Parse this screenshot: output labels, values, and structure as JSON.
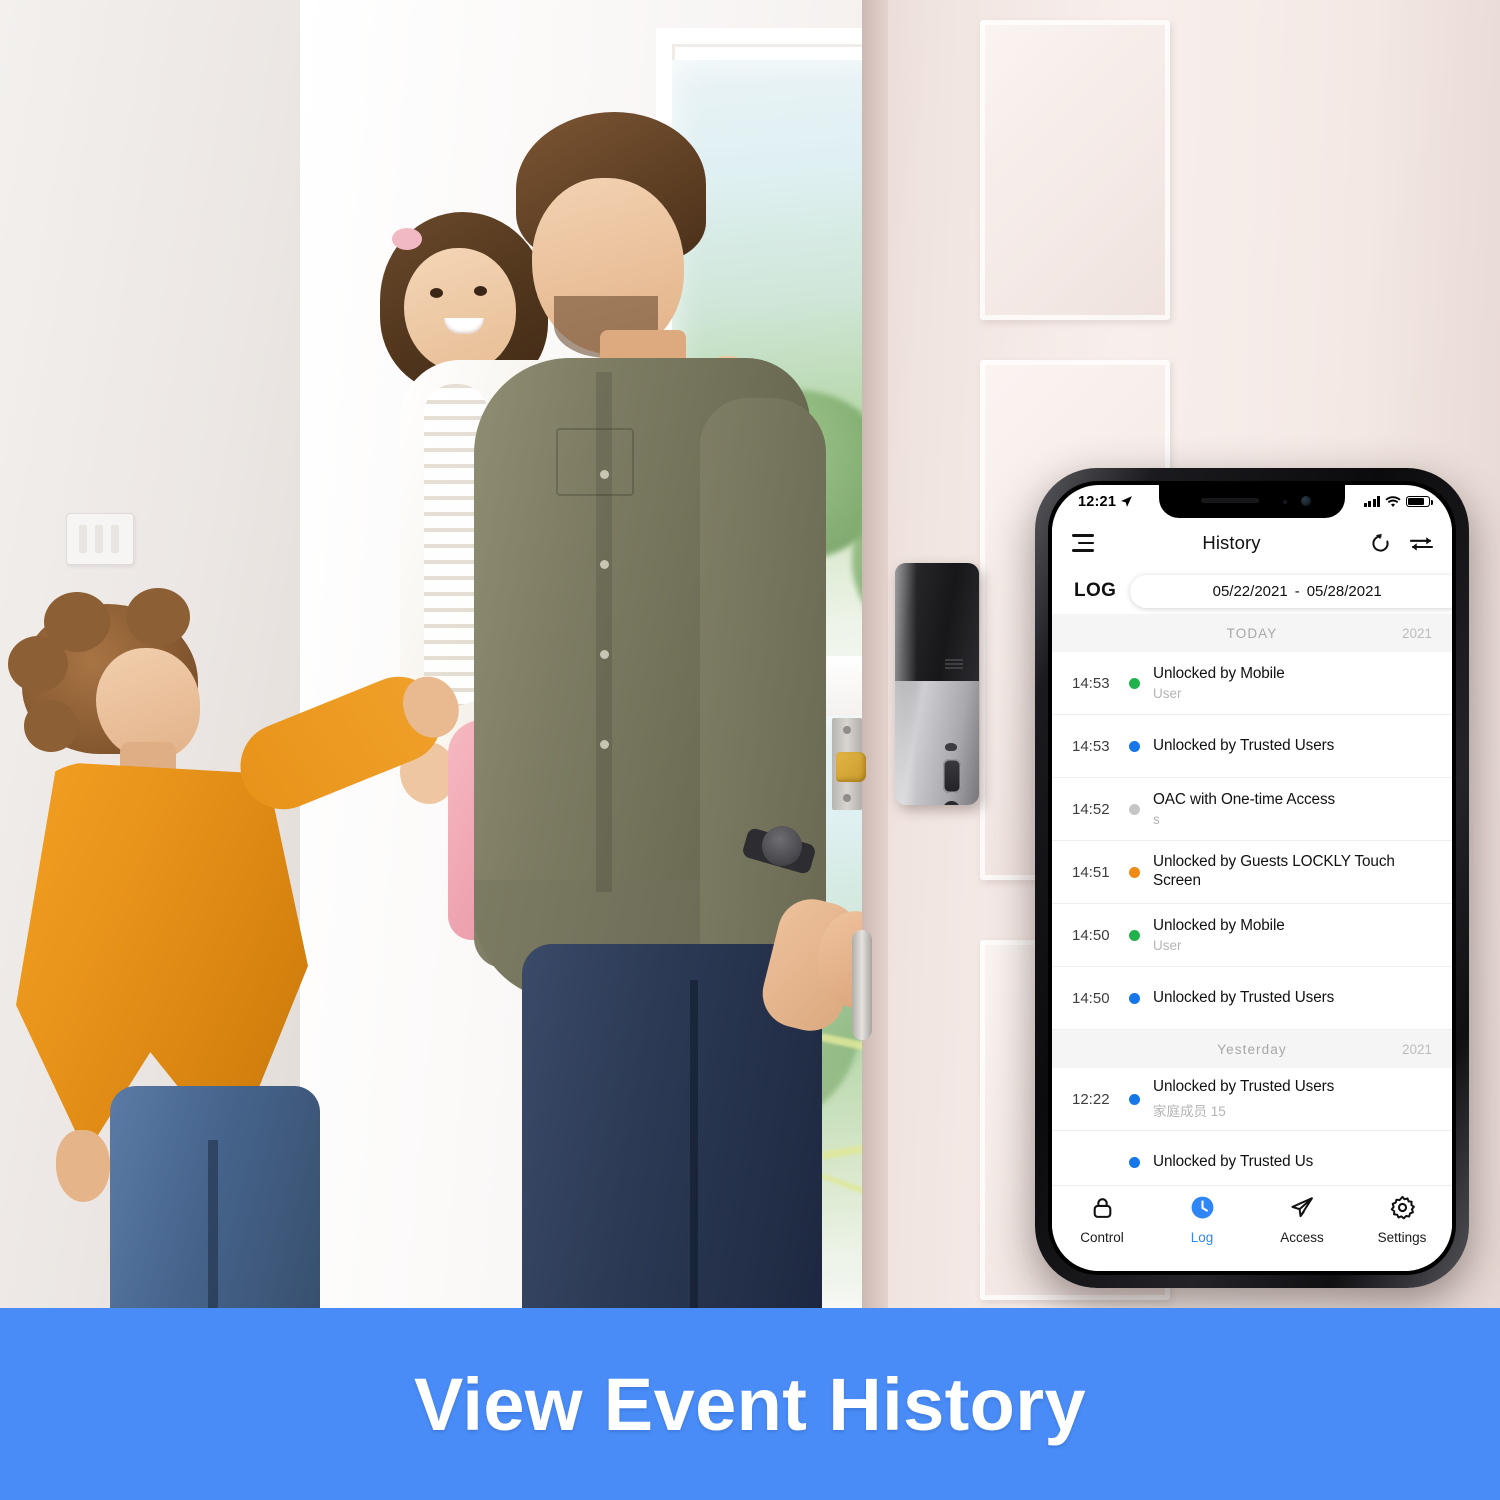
{
  "banner": {
    "headline": "View Event History",
    "color": "#4a8cf7"
  },
  "scene": {
    "description": "father carrying daughter on shoulders and son holding hands entering a front door with a smart lock",
    "smart_lock": "lockly-smart-deadbolt"
  },
  "phone": {
    "status_bar": {
      "time": "12:21",
      "location_icon": "location-arrow-icon",
      "signal_icon": "cellular-signal-icon",
      "wifi_icon": "wifi-icon",
      "battery_icon": "battery-icon"
    },
    "nav": {
      "menu_icon": "hamburger-menu-icon",
      "title": "History",
      "refresh_icon": "refresh-icon",
      "swap_icon": "transfer-swap-icon"
    },
    "log_header": {
      "label": "LOG",
      "date_start": "05/22/2021",
      "date_separator": "-",
      "date_end": "05/28/2021"
    },
    "sections": [
      {
        "title": "TODAY",
        "year": "2021",
        "rows": [
          {
            "time": "14:53",
            "dot": "#22b24c",
            "dot_name": "green",
            "title": "Unlocked by Mobile",
            "subtitle": "User"
          },
          {
            "time": "14:53",
            "dot": "#1677e8",
            "dot_name": "blue",
            "title": "Unlocked by Trusted Users",
            "subtitle": ""
          },
          {
            "time": "14:52",
            "dot": "#c6c6c6",
            "dot_name": "gray",
            "title": "OAC with One-time Access",
            "subtitle": "s"
          },
          {
            "time": "14:51",
            "dot": "#ef8a17",
            "dot_name": "orange",
            "title": "Unlocked by Guests LOCKLY Touch Screen",
            "subtitle": ""
          },
          {
            "time": "14:50",
            "dot": "#22b24c",
            "dot_name": "green",
            "title": "Unlocked by Mobile",
            "subtitle": "User"
          },
          {
            "time": "14:50",
            "dot": "#1677e8",
            "dot_name": "blue",
            "title": "Unlocked by Trusted Users",
            "subtitle": ""
          }
        ]
      },
      {
        "title": "Yesterday",
        "year": "2021",
        "rows": [
          {
            "time": "12:22",
            "dot": "#1677e8",
            "dot_name": "blue",
            "title": "Unlocked by Trusted Users",
            "subtitle": "家庭成员 15"
          },
          {
            "time": "",
            "dot": "#1677e8",
            "dot_name": "blue",
            "title": "Unlocked by Trusted Us",
            "subtitle": ""
          }
        ]
      }
    ],
    "tabs": [
      {
        "label": "Control",
        "icon": "lock-icon",
        "active": false
      },
      {
        "label": "Log",
        "icon": "clock-icon",
        "active": true
      },
      {
        "label": "Access",
        "icon": "paper-plane-icon",
        "active": false
      },
      {
        "label": "Settings",
        "icon": "gear-icon",
        "active": false
      }
    ],
    "active_tab_color": "#2f86f6"
  }
}
